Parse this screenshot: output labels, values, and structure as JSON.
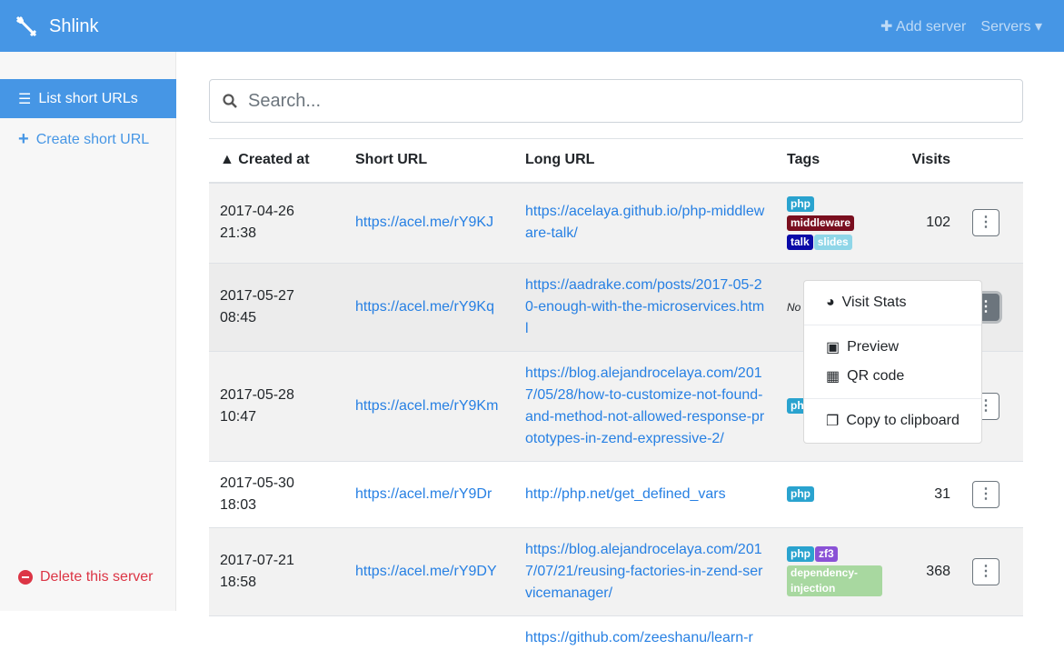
{
  "header": {
    "brand": "Shlink",
    "add_server": "Add server",
    "servers": "Servers",
    "color": "#4696e5"
  },
  "sidebar": {
    "items": [
      {
        "label": "List short URLs",
        "icon": "list-icon"
      },
      {
        "label": "Create short URL",
        "icon": "plus-icon"
      }
    ],
    "delete": "Delete this server"
  },
  "search": {
    "placeholder": "Search..."
  },
  "table": {
    "headers": [
      "Created at",
      "Short URL",
      "Long URL",
      "Tags",
      "Visits"
    ],
    "rows": [
      {
        "created": "2017-04-26 21:38",
        "short": "https://acel.me/rY9KJ",
        "long": "https://acelaya.github.io/php-middleware-talk/",
        "tags": [
          [
            "php",
            "#2aa3cf"
          ],
          [
            "middleware",
            "#7a0f1f"
          ],
          [
            "talk",
            "#0a0aa8"
          ],
          [
            "slides",
            "#8fd6e8"
          ]
        ],
        "visits": "102"
      },
      {
        "created": "2017-05-27 08:45",
        "short": "https://acel.me/rY9Kq",
        "long": "https://aadrake.com/posts/2017-05-20-enough-with-the-microservices.html",
        "tags": [],
        "no_tags": "No tags",
        "visits": ""
      },
      {
        "created": "2017-05-28 10:47",
        "short": "https://acel.me/rY9Km",
        "long": "https://blog.alejandrocelaya.com/2017/05/28/how-to-customize-not-found-and-method-not-allowed-response-prototypes-in-zend-expressive-2/",
        "tags": [
          [
            "php",
            "#2aa3cf"
          ]
        ],
        "visits": ""
      },
      {
        "created": "2017-05-30 18:03",
        "short": "https://acel.me/rY9Dr",
        "long": "http://php.net/get_defined_vars",
        "tags": [
          [
            "php",
            "#2aa3cf"
          ]
        ],
        "visits": "31"
      },
      {
        "created": "2017-07-21 18:58",
        "short": "https://acel.me/rY9DY",
        "long": "https://blog.alejandrocelaya.com/2017/07/21/reusing-factories-in-zend-servicemanager/",
        "tags": [
          [
            "php",
            "#2aa3cf"
          ],
          [
            "zf3",
            "#8a52d6"
          ],
          [
            "dependency-injection",
            "#a8d8a0"
          ]
        ],
        "visits": "368"
      },
      {
        "created": "",
        "short": "",
        "long": "https://github.com/zeeshanu/learn-r",
        "tags": [],
        "visits": ""
      }
    ]
  },
  "menu": {
    "items": [
      "Visit Stats",
      "Preview",
      "QR code",
      "Copy to clipboard"
    ]
  }
}
